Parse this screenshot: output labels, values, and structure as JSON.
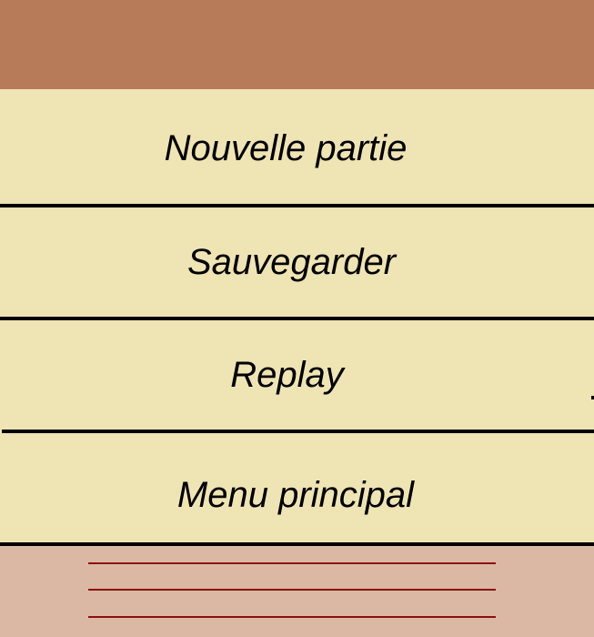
{
  "colors": {
    "top_bar": "#b87b5a",
    "menu_background": "#efe4b3",
    "divider": "#000000",
    "bottom_panel": "#dbb8a4",
    "hamburger_lines": "#8b1010"
  },
  "menu": {
    "items": [
      {
        "label": "Nouvelle partie"
      },
      {
        "label": "Sauvegarder"
      },
      {
        "label": "Replay"
      },
      {
        "label": "Menu principal"
      }
    ]
  },
  "bottom_panel": {
    "icon": "hamburger-menu-icon"
  }
}
